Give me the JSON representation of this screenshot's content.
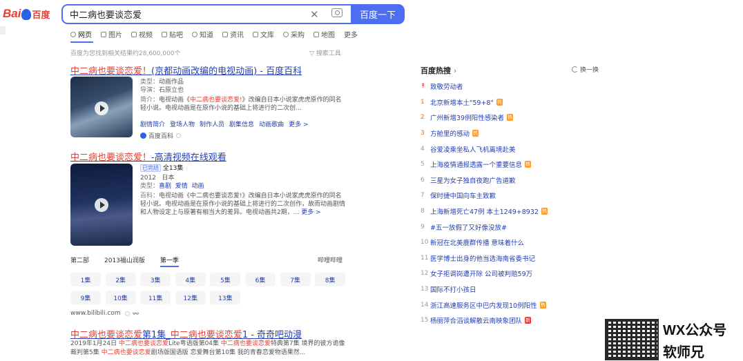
{
  "logo": {
    "brand_text": "Bai",
    "brand_text2": "百度"
  },
  "search": {
    "query": "中二病也要谈恋爱",
    "button_label": "百度一下"
  },
  "tabs": [
    {
      "label": "网页",
      "icon": "search-icon"
    },
    {
      "label": "图片",
      "icon": "image-icon"
    },
    {
      "label": "视频",
      "icon": "video-icon"
    },
    {
      "label": "贴吧",
      "icon": "tieba-icon"
    },
    {
      "label": "知道",
      "icon": "question-icon"
    },
    {
      "label": "资讯",
      "icon": "news-icon"
    },
    {
      "label": "文库",
      "icon": "doc-icon"
    },
    {
      "label": "采购",
      "icon": "purchase-icon"
    },
    {
      "label": "地图",
      "icon": "map-icon"
    },
    {
      "label": "更多"
    }
  ],
  "results_count": "百度为您找到相关结果约28,600,000个",
  "search_tools": "搜索工具",
  "result1": {
    "title_em": "中二病也要谈恋爱！",
    "title_rest": "(京都动画改编的电视动画) - 百度百科",
    "type_label": "类型：",
    "type_value": "动画作品",
    "director_label": "导演：",
    "director_value": "石原立也",
    "intro_label": "简介：",
    "intro_pre": "电视动画《",
    "intro_em": "中二病也要谈恋爱!",
    "intro_post": "》改编自日本小说家虎虎原作的同名轻小说。电视动画是在原作小说的基础上将进行的二次创...",
    "sublinks": [
      "剧情简介",
      "登场人物",
      "制作人员",
      "剧集信息",
      "动画歌曲",
      "更多 >"
    ],
    "source": "百度百科"
  },
  "result2": {
    "title_em": "中二病也要谈恋爱！",
    "title_rest": "-高清视频在线观看",
    "status_badge": "已完结",
    "episodes_total": "全13集",
    "year": "2012",
    "country": "日本",
    "type_label": "类型：",
    "types": [
      "喜剧",
      "爱情",
      "动画"
    ],
    "intro_label": "百科：",
    "intro": "电视动画《中二病也要谈恋爱!》改编自日本小说家虎虎原作的同名轻小说。电视动画是在原作小说的基础上将进行的二次创作，故而动画剧情和人物设定上与原著有相当大的差异。电视动画共2期，...",
    "more": "更多 >",
    "seasons": [
      "第二部",
      "2013福山润版",
      "第一季"
    ],
    "platform": "哔哩哔哩",
    "episodes": [
      "1集",
      "2集",
      "3集",
      "4集",
      "5集",
      "6集",
      "7集",
      "8集",
      "9集",
      "10集",
      "11集",
      "12集",
      "13集"
    ],
    "url": "www.bilibili.com"
  },
  "result3": {
    "title_em1": "中二病也要谈恋爱",
    "title_mid": "第1集_",
    "title_em2": "中二病也要谈恋爱",
    "title_rest": "1 - 奇奇吧动漫",
    "snippet_date": "2019年1月24日",
    "snippet_em1": "中二病也要谈恋爱",
    "snippet_t1": "Lite粤语版第04集",
    "snippet_em2": "中二病也要谈恋爱",
    "snippet_t2": "特典第7集 境界的彼方诡像裁判第5集",
    "snippet_em3": "中二病也要谈恋爱",
    "snippet_t3": "剧场版国语版 恋爱舞台第10集 我的青春恋爱物语果然..."
  },
  "hot": {
    "title": "百度热搜",
    "refresh": "换一换",
    "items": [
      {
        "rank": "",
        "text": "致敬劳动者",
        "tag": ""
      },
      {
        "rank": "1",
        "text": "北京新增本土\"59+8\"",
        "tag": "热"
      },
      {
        "rank": "2",
        "text": "广州新增39例阳性感染者",
        "tag": "热"
      },
      {
        "rank": "3",
        "text": "方舱里的感动",
        "tag": "热"
      },
      {
        "rank": "4",
        "text": "谷爱凌乘坐私人飞机离境赴美",
        "tag": ""
      },
      {
        "rank": "5",
        "text": "上海疫情通报透露一个重要信息",
        "tag": "热"
      },
      {
        "rank": "6",
        "text": "三星为女子独自夜跑广告道歉",
        "tag": ""
      },
      {
        "rank": "7",
        "text": "保时捷中国向车主致歉",
        "tag": ""
      },
      {
        "rank": "8",
        "text": "上海新增死亡47例 本土1249+8932",
        "tag": "热"
      },
      {
        "rank": "9",
        "text": "#五一放假了又好像没放#",
        "tag": ""
      },
      {
        "rank": "10",
        "text": "新冠在北美鹿群传播 意味着什么",
        "tag": ""
      },
      {
        "rank": "11",
        "text": "医学博士出身的他当选海南省委书记",
        "tag": ""
      },
      {
        "rank": "12",
        "text": "女子拒调岗遭开除 公司被判赔59万",
        "tag": ""
      },
      {
        "rank": "13",
        "text": "国际不打小孩日",
        "tag": ""
      },
      {
        "rank": "14",
        "text": "浙江高速服务区中巴内发现10例阳性",
        "tag": "热"
      },
      {
        "rank": "15",
        "text": "杨丽萍合滔谈解散云南映象团队",
        "tag": "新"
      }
    ]
  },
  "watermark": {
    "line1": "WX公众号",
    "line2": "软师兄"
  },
  "colors": {
    "accent": "#4e6ef2",
    "link": "#2440b3",
    "red": "#e33e33",
    "hot_tag": "#ff9a1f"
  }
}
